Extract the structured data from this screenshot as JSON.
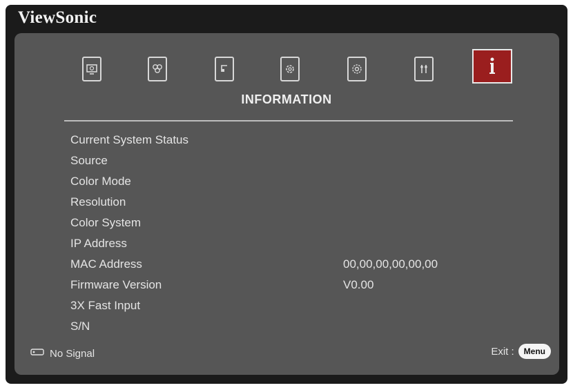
{
  "brand": "ViewSonic",
  "colors": {
    "frame": "#1b1b1b",
    "panel": "#565656",
    "active_tab": "#9a1e1e",
    "text": "#e4e4e4"
  },
  "menu_tabs": [
    {
      "icon": "display-icon",
      "active": false
    },
    {
      "icon": "picture-icon",
      "active": false
    },
    {
      "icon": "power-management-icon",
      "active": false
    },
    {
      "icon": "basic-settings-icon",
      "active": false
    },
    {
      "icon": "advanced-settings-icon",
      "active": false
    },
    {
      "icon": "network-icon",
      "active": false
    },
    {
      "icon": "information-icon",
      "active": true
    }
  ],
  "section_title": "INFORMATION",
  "info_rows": [
    {
      "label": "Current System Status",
      "value": ""
    },
    {
      "label": "Source",
      "value": ""
    },
    {
      "label": "Color Mode",
      "value": ""
    },
    {
      "label": "Resolution",
      "value": ""
    },
    {
      "label": "Color System",
      "value": ""
    },
    {
      "label": "IP Address",
      "value": ""
    },
    {
      "label": "MAC Address",
      "value": "00,00,00,00,00,00"
    },
    {
      "label": "Firmware Version",
      "value": "V0.00"
    },
    {
      "label": "3X Fast Input",
      "value": ""
    },
    {
      "label": "S/N",
      "value": ""
    }
  ],
  "footer": {
    "left_icon": "remote-control-icon",
    "left_text": "No Signal",
    "exit_text": "Exit :",
    "menu_button": "Menu"
  }
}
